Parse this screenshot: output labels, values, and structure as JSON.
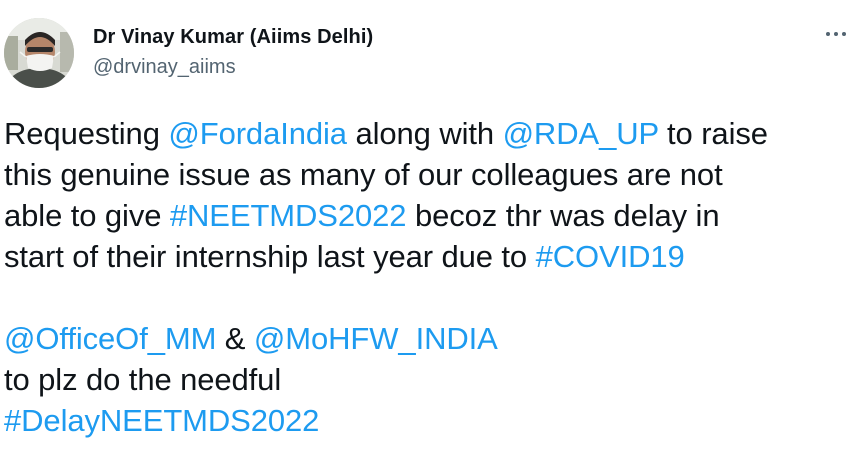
{
  "author": {
    "display_name": "Dr Vinay Kumar (Aiims Delhi)",
    "handle": "@drvinay_aiims",
    "avatar_icon": "profile-photo"
  },
  "more_icon": "more-horizontal-icon",
  "tweet": {
    "line1": {
      "t1": "Requesting ",
      "mention1": "@FordaIndia",
      "t2": " along with ",
      "mention2": "@RDA_UP",
      "t3": " to raise"
    },
    "line2": "this genuine issue as many of our colleagues are not",
    "line3": {
      "t1": "able to give ",
      "hashtag": "#NEETMDS2022",
      "t2": " becoz thr was delay in"
    },
    "line4": {
      "t1": "start of their internship last year due to ",
      "hashtag": "#COVID19"
    },
    "line5": {
      "mention1": "@OfficeOf_MM",
      "t1": " & ",
      "mention2": "@MoHFW_INDIA"
    },
    "line6": "to plz do the needful",
    "line7": {
      "hashtag": "#DelayNEETMDS2022"
    }
  },
  "colors": {
    "link": "#1d9bf0",
    "text": "#0f1419",
    "secondary": "#536471"
  }
}
